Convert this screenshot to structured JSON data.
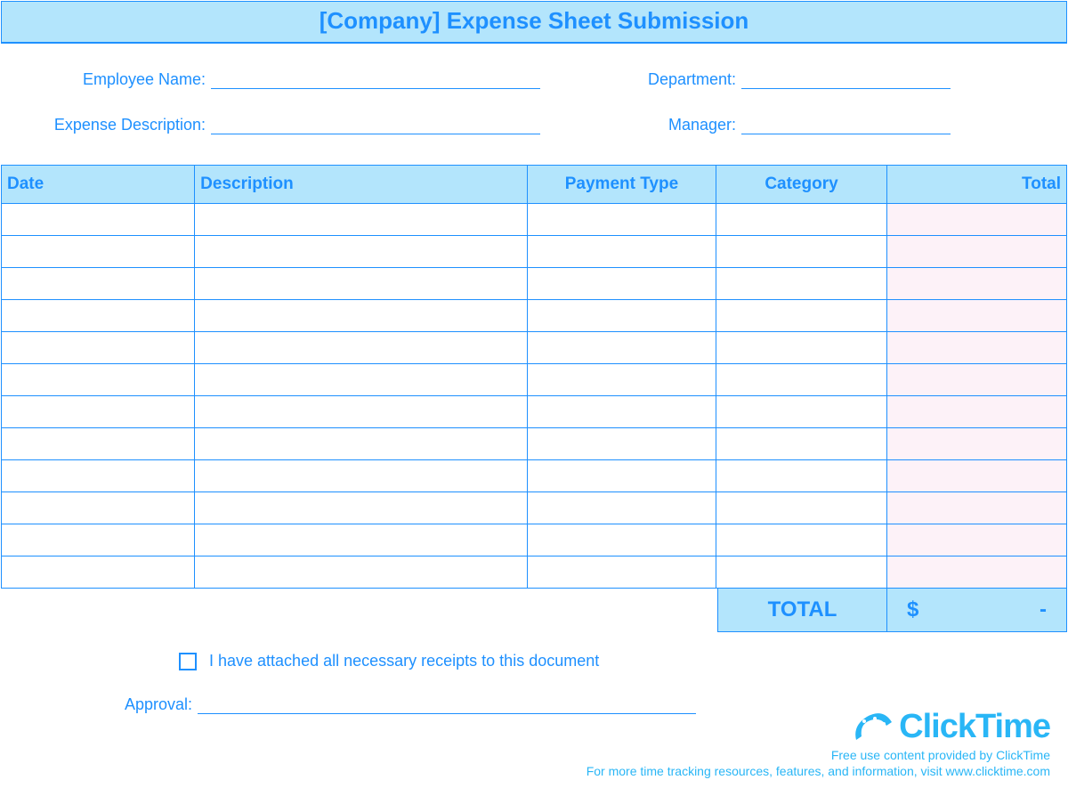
{
  "title": "[Company] Expense Sheet Submission",
  "fields": {
    "employee_name_label": "Employee Name:",
    "department_label": "Department:",
    "expense_description_label": "Expense Description:",
    "manager_label": "Manager:",
    "approval_label": "Approval:"
  },
  "table": {
    "headers": {
      "date": "Date",
      "description": "Description",
      "payment_type": "Payment Type",
      "category": "Category",
      "total": "Total"
    },
    "row_count": 12
  },
  "totals": {
    "label": "TOTAL",
    "currency": "$",
    "value": "-"
  },
  "receipts_attestation": "I have attached all necessary receipts to this document",
  "footer": {
    "brand": "ClickTime",
    "line1": "Free use content provided by ClickTime",
    "line2": "For more time tracking resources, features, and information, visit www.clicktime.com"
  }
}
